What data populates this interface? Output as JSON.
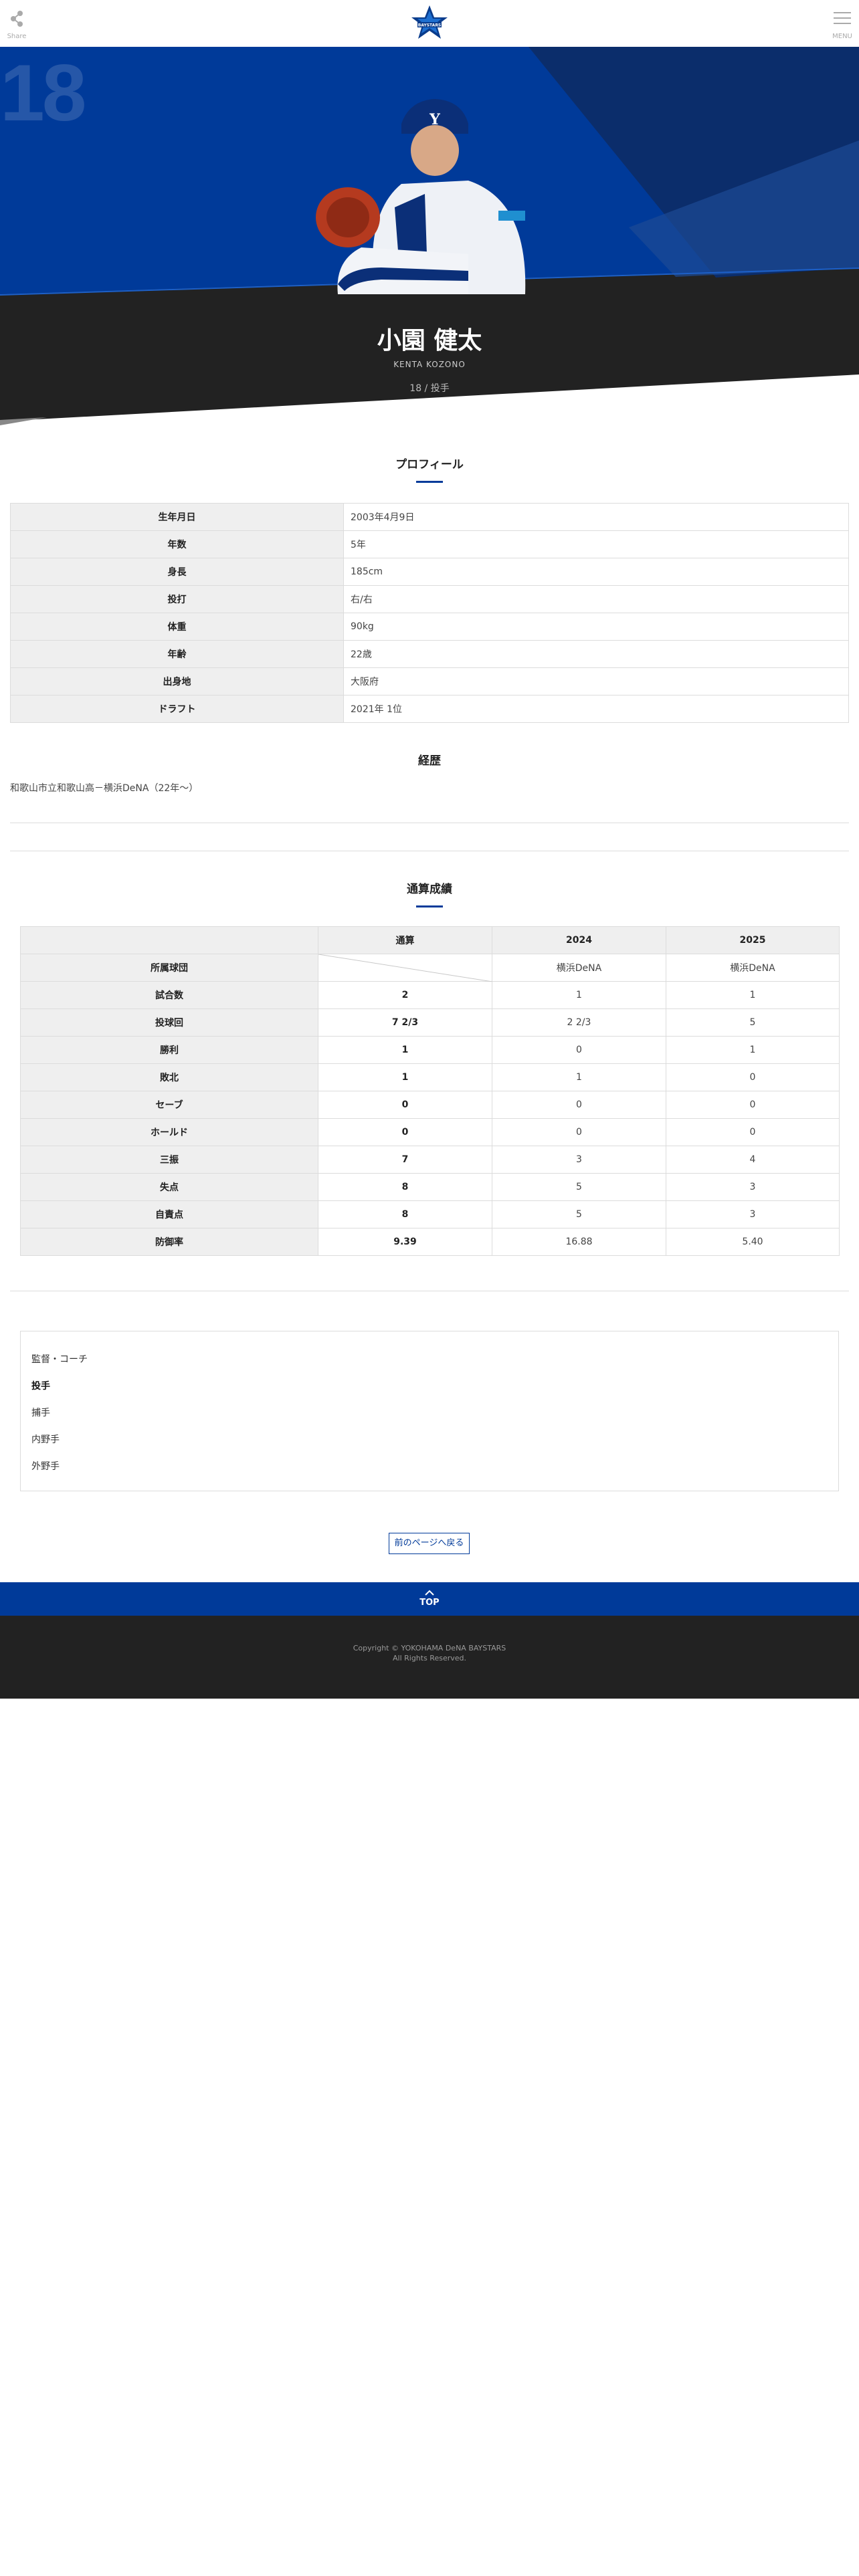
{
  "header": {
    "share_label": "Share",
    "menu_label": "MENU",
    "logo_text": "BAYSTARS"
  },
  "hero": {
    "number": "18",
    "name": "小園 健太",
    "name_en": "KENTA KOZONO",
    "meta": "18 / 投手",
    "colors": {
      "blue": "#003a99",
      "dark": "#222222"
    }
  },
  "profile": {
    "title": "プロフィール",
    "rows": [
      {
        "label": "生年月日",
        "value": "2003年4月9日"
      },
      {
        "label": "年数",
        "value": "5年"
      },
      {
        "label": "身長",
        "value": "185cm"
      },
      {
        "label": "投打",
        "value": "右/右"
      },
      {
        "label": "体重",
        "value": "90kg"
      },
      {
        "label": "年齢",
        "value": "22歳"
      },
      {
        "label": "出身地",
        "value": "大阪府"
      },
      {
        "label": "ドラフト",
        "value": "2021年  1位"
      }
    ]
  },
  "career": {
    "title": "経歴",
    "text": "和歌山市立和歌山高－横浜DeNA（22年〜）"
  },
  "stats": {
    "title": "通算成績",
    "headers": [
      "",
      "通算",
      "2024",
      "2025"
    ],
    "team_row": {
      "label": "所属球団",
      "values": [
        "横浜DeNA",
        "横浜DeNA"
      ]
    },
    "rows": [
      {
        "label": "試合数",
        "total": "2",
        "values": [
          "1",
          "1"
        ]
      },
      {
        "label": "投球回",
        "total": "7 2/3",
        "values": [
          "2 2/3",
          "5"
        ]
      },
      {
        "label": "勝利",
        "total": "1",
        "values": [
          "0",
          "1"
        ]
      },
      {
        "label": "敗北",
        "total": "1",
        "values": [
          "1",
          "0"
        ]
      },
      {
        "label": "セーブ",
        "total": "0",
        "values": [
          "0",
          "0"
        ]
      },
      {
        "label": "ホールド",
        "total": "0",
        "values": [
          "0",
          "0"
        ]
      },
      {
        "label": "三振",
        "total": "7",
        "values": [
          "3",
          "4"
        ]
      },
      {
        "label": "失点",
        "total": "8",
        "values": [
          "5",
          "3"
        ]
      },
      {
        "label": "自責点",
        "total": "8",
        "values": [
          "5",
          "3"
        ]
      },
      {
        "label": "防御率",
        "total": "9.39",
        "values": [
          "16.88",
          "5.40"
        ]
      }
    ]
  },
  "categories": {
    "items": [
      "監督・コーチ",
      "投手",
      "捕手",
      "内野手",
      "外野手"
    ],
    "active": "投手"
  },
  "back_button": "前のページへ戻る",
  "top_button": "TOP",
  "footer": {
    "line1": "Copyright © YOKOHAMA DeNA BAYSTARS",
    "line2": "All Rights Reserved."
  }
}
